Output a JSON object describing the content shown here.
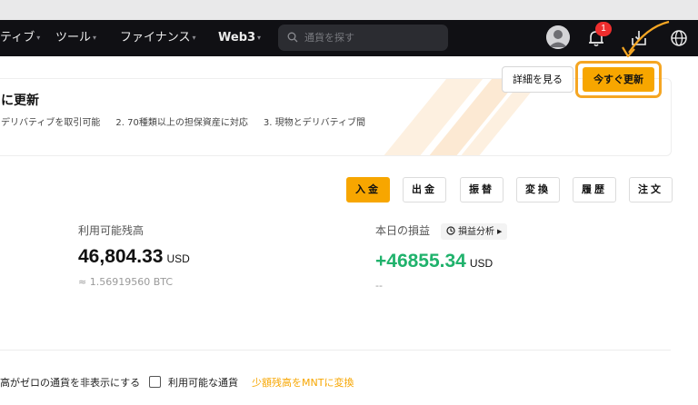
{
  "nav": {
    "items": [
      {
        "label": "ティブ",
        "caret": "▾"
      },
      {
        "label": "ツール",
        "caret": "▾"
      },
      {
        "label": "ファイナンス",
        "caret": "▾"
      },
      {
        "label": "Web3",
        "caret": "▾"
      }
    ],
    "search_placeholder": "通貨を探す",
    "notification_count": "1"
  },
  "banner": {
    "title": "に更新",
    "features": [
      "デリバティブを取引可能",
      "2. 70種類以上の担保資産に対応",
      "3. 現物とデリバティブ間"
    ],
    "details_button": "詳細を見る",
    "update_button": "今すぐ更新"
  },
  "actions": [
    "入金",
    "出金",
    "振替",
    "変換",
    "履歴",
    "注文"
  ],
  "balance": {
    "label": "利用可能残高",
    "value": "46,804.33",
    "unit": "USD",
    "btc_equiv": "≈ 1.56919560 BTC"
  },
  "pnl": {
    "label": "本日の損益",
    "analysis_button": "損益分析",
    "value": "+46855.34",
    "unit": "USD",
    "sub": "--"
  },
  "filters": {
    "hide_zero": "高がゼロの通貨を非表示にする",
    "available_only": "利用可能な通貨",
    "convert_link": "少額残高をMNTに変換"
  },
  "colors": {
    "accent": "#f7a600",
    "profit": "#20b26c",
    "nav_bg": "#101014",
    "badge": "#ef2e2e"
  }
}
